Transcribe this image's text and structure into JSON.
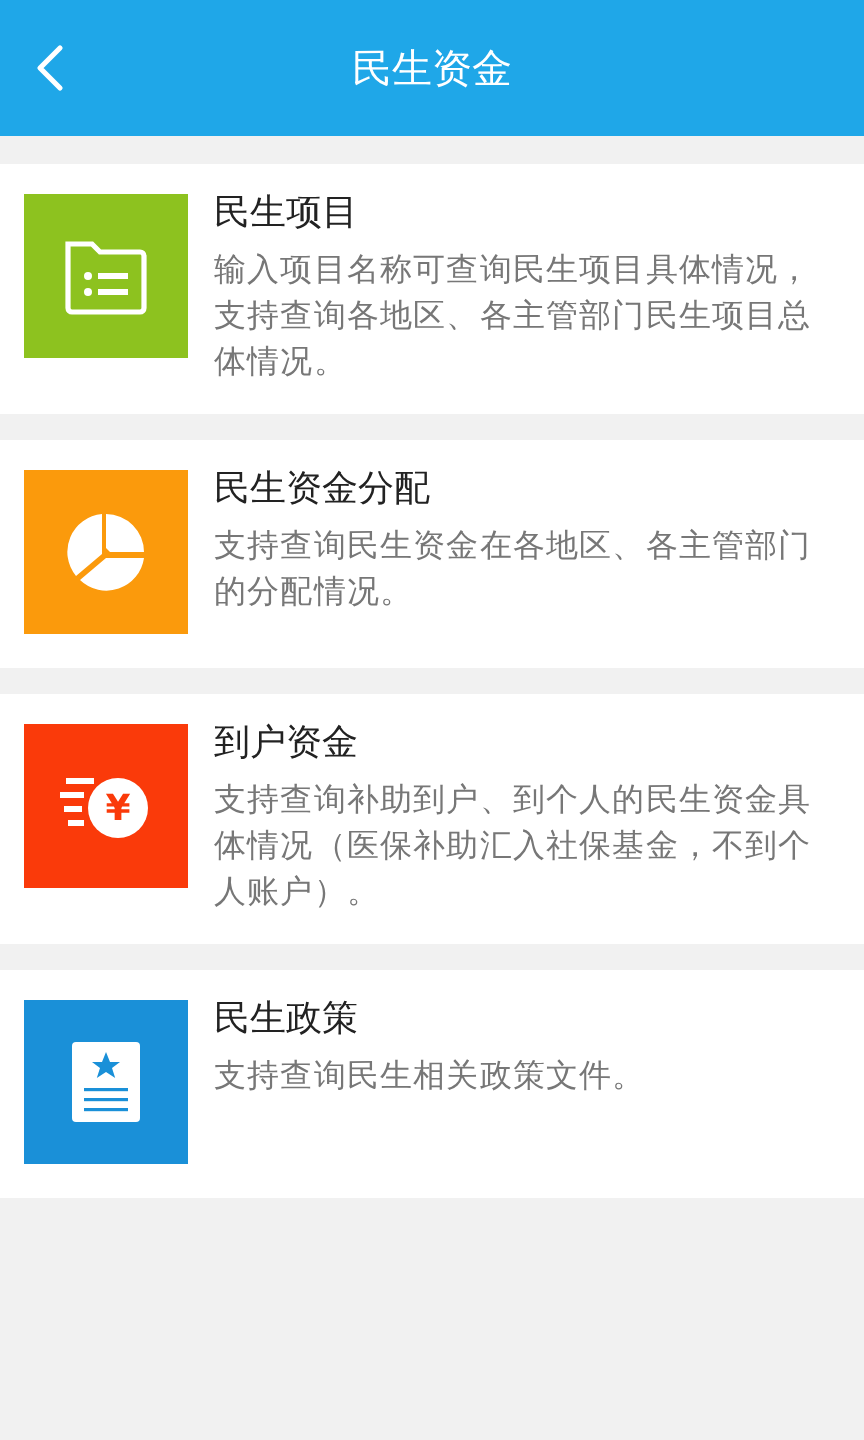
{
  "header": {
    "title": "民生资金"
  },
  "items": [
    {
      "kind": "folder",
      "color": "#8dc21f",
      "title": "民生项目",
      "description": "输入项目名称可查询民生项目具体情况，支持查询各地区、各主管部门民生项目总体情况。"
    },
    {
      "kind": "pie",
      "color": "#fb9a0c",
      "title": "民生资金分配",
      "description": "支持查询民生资金在各地区、各主管部门的分配情况。"
    },
    {
      "kind": "coin",
      "color": "#fa3a0a",
      "icon_glyph": "¥",
      "title": "到户资金",
      "description": "支持查询补助到户、到个人的民生资金具体情况（医保补助汇入社保基金，不到个人账户）。"
    },
    {
      "kind": "document",
      "color": "#1a90d8",
      "title": "民生政策",
      "description": "支持查询民生相关政策文件。"
    }
  ]
}
